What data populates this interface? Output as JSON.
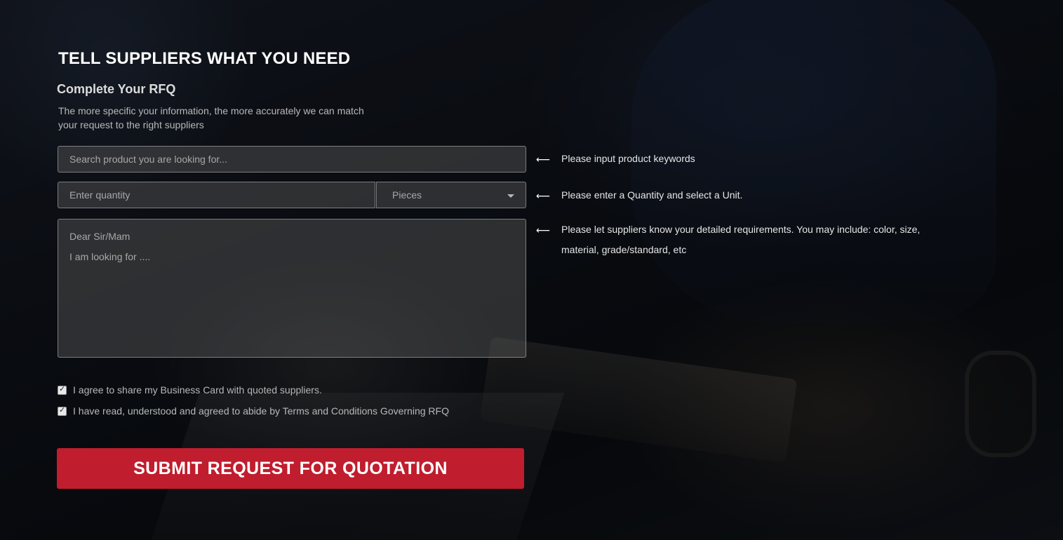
{
  "form": {
    "heading": "TELL SUPPLIERS WHAT YOU NEED",
    "subheading": "Complete Your RFQ",
    "description": "The more specific your information, the more accurately we can match your request to the right suppliers",
    "search": {
      "placeholder": "Search product you are looking for...",
      "value": ""
    },
    "quantity": {
      "placeholder": "Enter quantity",
      "value": ""
    },
    "unit": {
      "selected": "Pieces"
    },
    "requirements": {
      "placeholder": "Dear Sir/Mam\nI am looking for ....",
      "value": ""
    },
    "checkboxes": [
      {
        "label": "I agree to share my Business Card with quoted suppliers.",
        "checked": true
      },
      {
        "label": "I have read, understood and agreed to abide by Terms and Conditions Governing RFQ",
        "checked": true
      }
    ],
    "submit_label": "SUBMIT REQUEST FOR QUOTATION"
  },
  "hints": {
    "arrow": "⟵",
    "keywords": "Please input product keywords",
    "quantity": "Please enter a Quantity and select a Unit.",
    "requirements": "Please let suppliers know your detailed requirements. You may include: color, size, material, grade/standard, etc"
  },
  "colors": {
    "submit_button": "#c01d2e",
    "heading_text": "#ffffff"
  }
}
